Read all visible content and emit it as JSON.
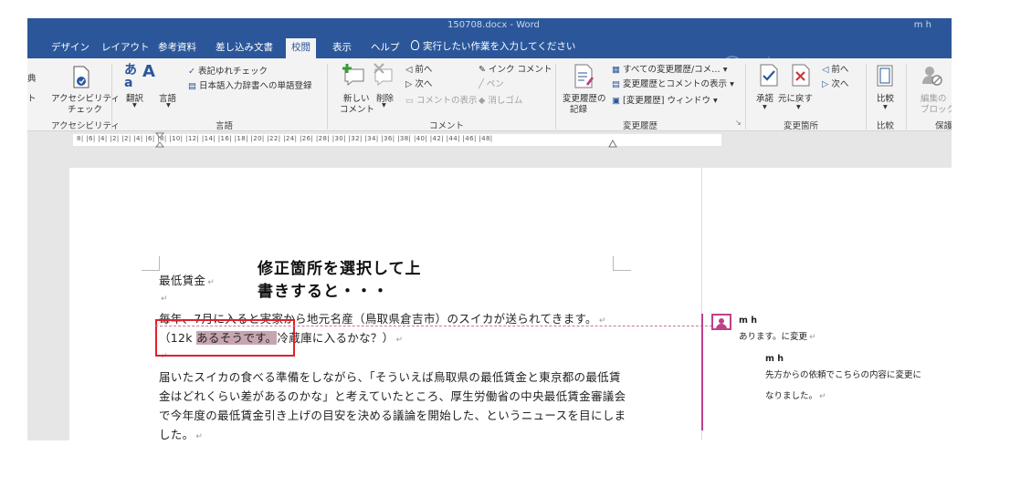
{
  "window": {
    "title": "150708.docx - Word",
    "user": "m h"
  },
  "menu": {
    "tabs": [
      "デザイン",
      "レイアウト",
      "参考資料",
      "差し込み文書",
      "校閲",
      "表示",
      "ヘルプ"
    ],
    "active_tab": "校閲",
    "tell_me": "実行したい作業を入力してください"
  },
  "ribbon": {
    "left_edge": [
      "典",
      "ト"
    ],
    "accessibility": {
      "button": "アクセシビリティ",
      "button2": "チェック",
      "group": "アクセシビリティ"
    },
    "language": {
      "translate": "翻訳",
      "language": "言語",
      "spelling": "表記ゆれチェック",
      "dictionary": "日本語入力辞書への単語登録",
      "group": "言語"
    },
    "comments": {
      "new": "新しい",
      "new2": "コメント",
      "delete": "削除",
      "prev": "前へ",
      "next": "次へ",
      "show": "コメントの表示",
      "ink": "インク コメント",
      "pen": "ペン",
      "eraser": "消しゴム",
      "group": "コメント"
    },
    "tracking": {
      "track": "変更履歴の",
      "track2": "記録",
      "display": "すべての変更履歴/コメ…",
      "show_markup": "変更履歴とコメントの表示",
      "pane": "[変更履歴] ウィンドウ",
      "group": "変更履歴"
    },
    "changes": {
      "accept": "承諾",
      "reject": "元に戻す",
      "prev": "前へ",
      "next": "次へ",
      "group": "変更箇所"
    },
    "compare": {
      "button": "比較",
      "group": "比較"
    },
    "protect": {
      "button": "編集の",
      "button2": "ブロック",
      "group": "保護"
    }
  },
  "ruler": {
    "marks": "8|  |6|  |4|  |2|     |2|  |4|  |6|  |8|  |10|  |12|  |14|  |16|  |18|  |20|  |22|  |24|  |26|  |28|  |30|  |32|  |34|  |36|  |38|  |40|  |42|  |44|  |46|  |48|"
  },
  "document": {
    "heading": "最低賃金",
    "line1": "毎年、7月に入ると実家から地元名産（鳥取県倉吉市）のスイカが送られてきます。",
    "line2_before": "（12k ",
    "line2_selected": "あるそうです。",
    "line2_after": "冷蔵庫に入るかな？）",
    "para2": [
      "届いたスイカの食べる準備をしながら、「そういえば鳥取県の最低賃金と東京都の最低賃",
      "金はどれくらい差があるのかな」と考えていたところ、厚生労働省の中央最低賃金審議会",
      "で今年度の最低賃金引き上げの目安を決める議論を開始した、というニュースを目にしま",
      "した。"
    ],
    "pilcrow": "↵"
  },
  "overlay_note": [
    "修正箇所を選択して上",
    "書きすると・・・"
  ],
  "comments": [
    {
      "author": "m h",
      "text": "あります。に変更"
    },
    {
      "author": "m h",
      "text_lines": [
        "先方からの依頼でこちらの内容に変更に",
        "なりました。"
      ]
    }
  ],
  "colors": {
    "ribbon_blue": "#2b579a",
    "selection": "#c6a5b1",
    "highlight_box": "#e0212a",
    "comment_accent": "#c0408a"
  }
}
